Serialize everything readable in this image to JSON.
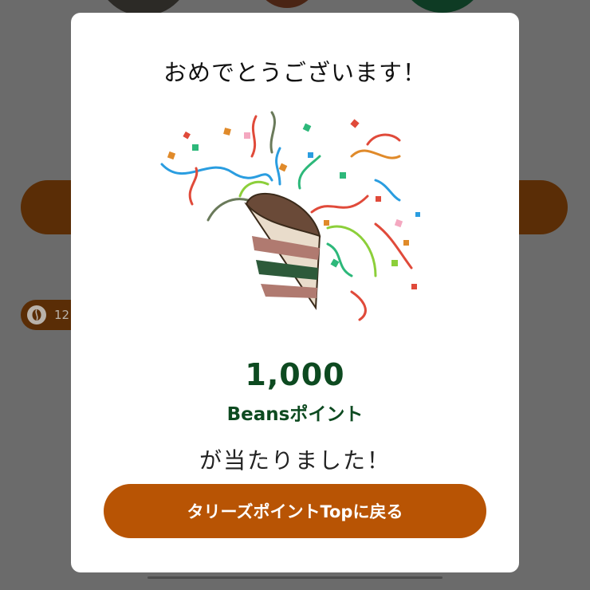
{
  "background": {
    "chip_text": "12",
    "chip_icon": "coffee-bean-icon"
  },
  "modal": {
    "title": "おめでとうございます！",
    "illustration": "party-popper-icon",
    "points_value": "1,000",
    "points_unit": "Beansポイント",
    "won_text": "が当たりました！",
    "back_button_label": "タリーズポイントTopに戻る"
  },
  "colors": {
    "accent": "#b85404",
    "points_green": "#0d4a20",
    "overlay": "#6b6b6b"
  }
}
